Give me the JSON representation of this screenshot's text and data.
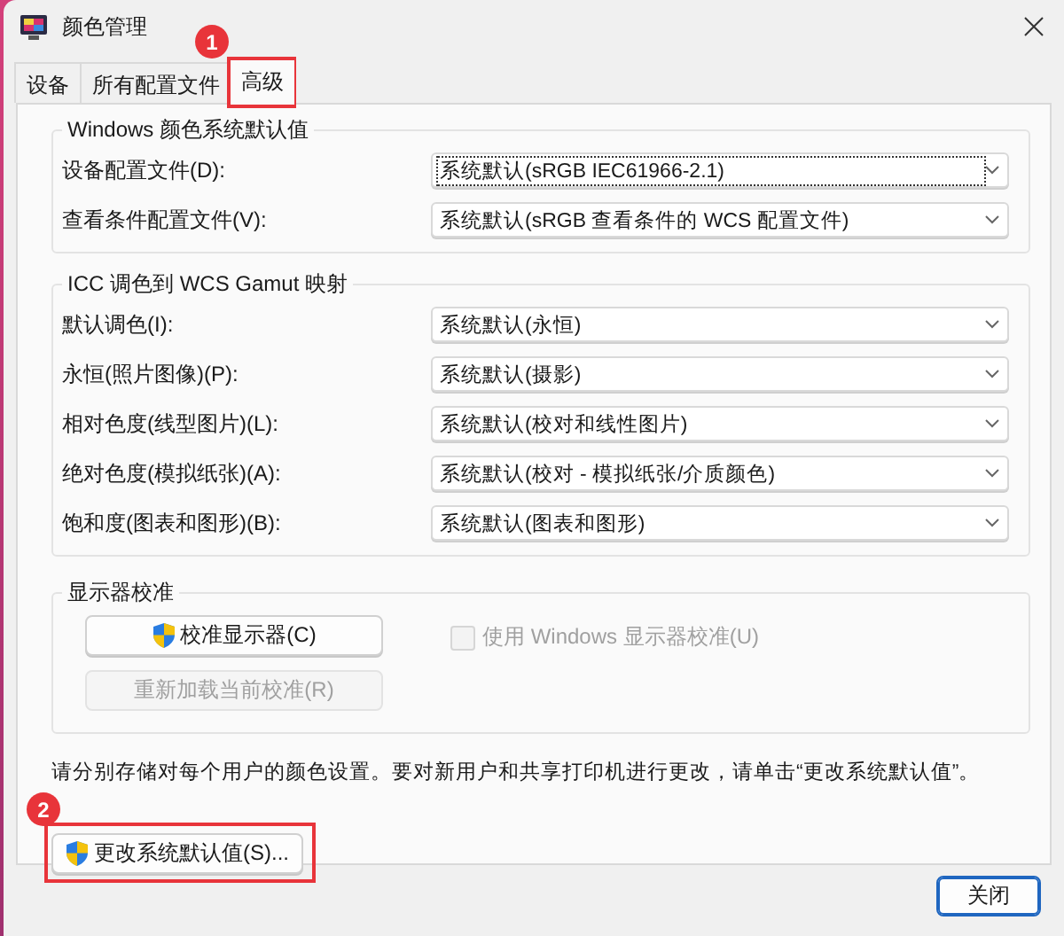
{
  "window": {
    "title": "颜色管理"
  },
  "tabs": [
    {
      "label": "设备",
      "selected": false
    },
    {
      "label": "所有配置文件",
      "selected": false
    },
    {
      "label": "高级",
      "selected": true,
      "annotation": "1"
    }
  ],
  "groups": [
    {
      "title": "Windows 颜色系统默认值",
      "rows": [
        {
          "label": "设备配置文件(D):",
          "value": "系统默认(sRGB IEC61966-2.1)",
          "focused": true
        },
        {
          "label": "查看条件配置文件(V):",
          "value": "系统默认(sRGB 查看条件的 WCS 配置文件)",
          "focused": false
        }
      ]
    },
    {
      "title": "ICC 调色到 WCS Gamut 映射",
      "rows": [
        {
          "label": "默认调色(I):",
          "value": "系统默认(永恒)",
          "focused": false
        },
        {
          "label": "永恒(照片图像)(P):",
          "value": "系统默认(摄影)",
          "focused": false
        },
        {
          "label": "相对色度(线型图片)(L):",
          "value": "系统默认(校对和线性图片)",
          "focused": false
        },
        {
          "label": "绝对色度(模拟纸张)(A):",
          "value": "系统默认(校对 - 模拟纸张/介质颜色)",
          "focused": false
        },
        {
          "label": "饱和度(图表和图形)(B):",
          "value": "系统默认(图表和图形)",
          "focused": false
        }
      ]
    }
  ],
  "calibration": {
    "title": "显示器校准",
    "buttons": [
      {
        "label": "校准显示器(C)",
        "disabled": false,
        "shield": true
      },
      {
        "label": "重新加载当前校准(R)",
        "disabled": true,
        "shield": false
      }
    ],
    "checkbox": {
      "label": "使用 Windows 显示器校准(U)",
      "checked": false,
      "disabled": true
    }
  },
  "note": "请分别存储对每个用户的颜色设置。要对新用户和共享打印机进行更改，请单击“更改系统默认值”。",
  "change_button": {
    "label": "更改系统默认值(S)...",
    "shield": true,
    "annotation": "2"
  },
  "close_button": {
    "label": "关闭"
  }
}
